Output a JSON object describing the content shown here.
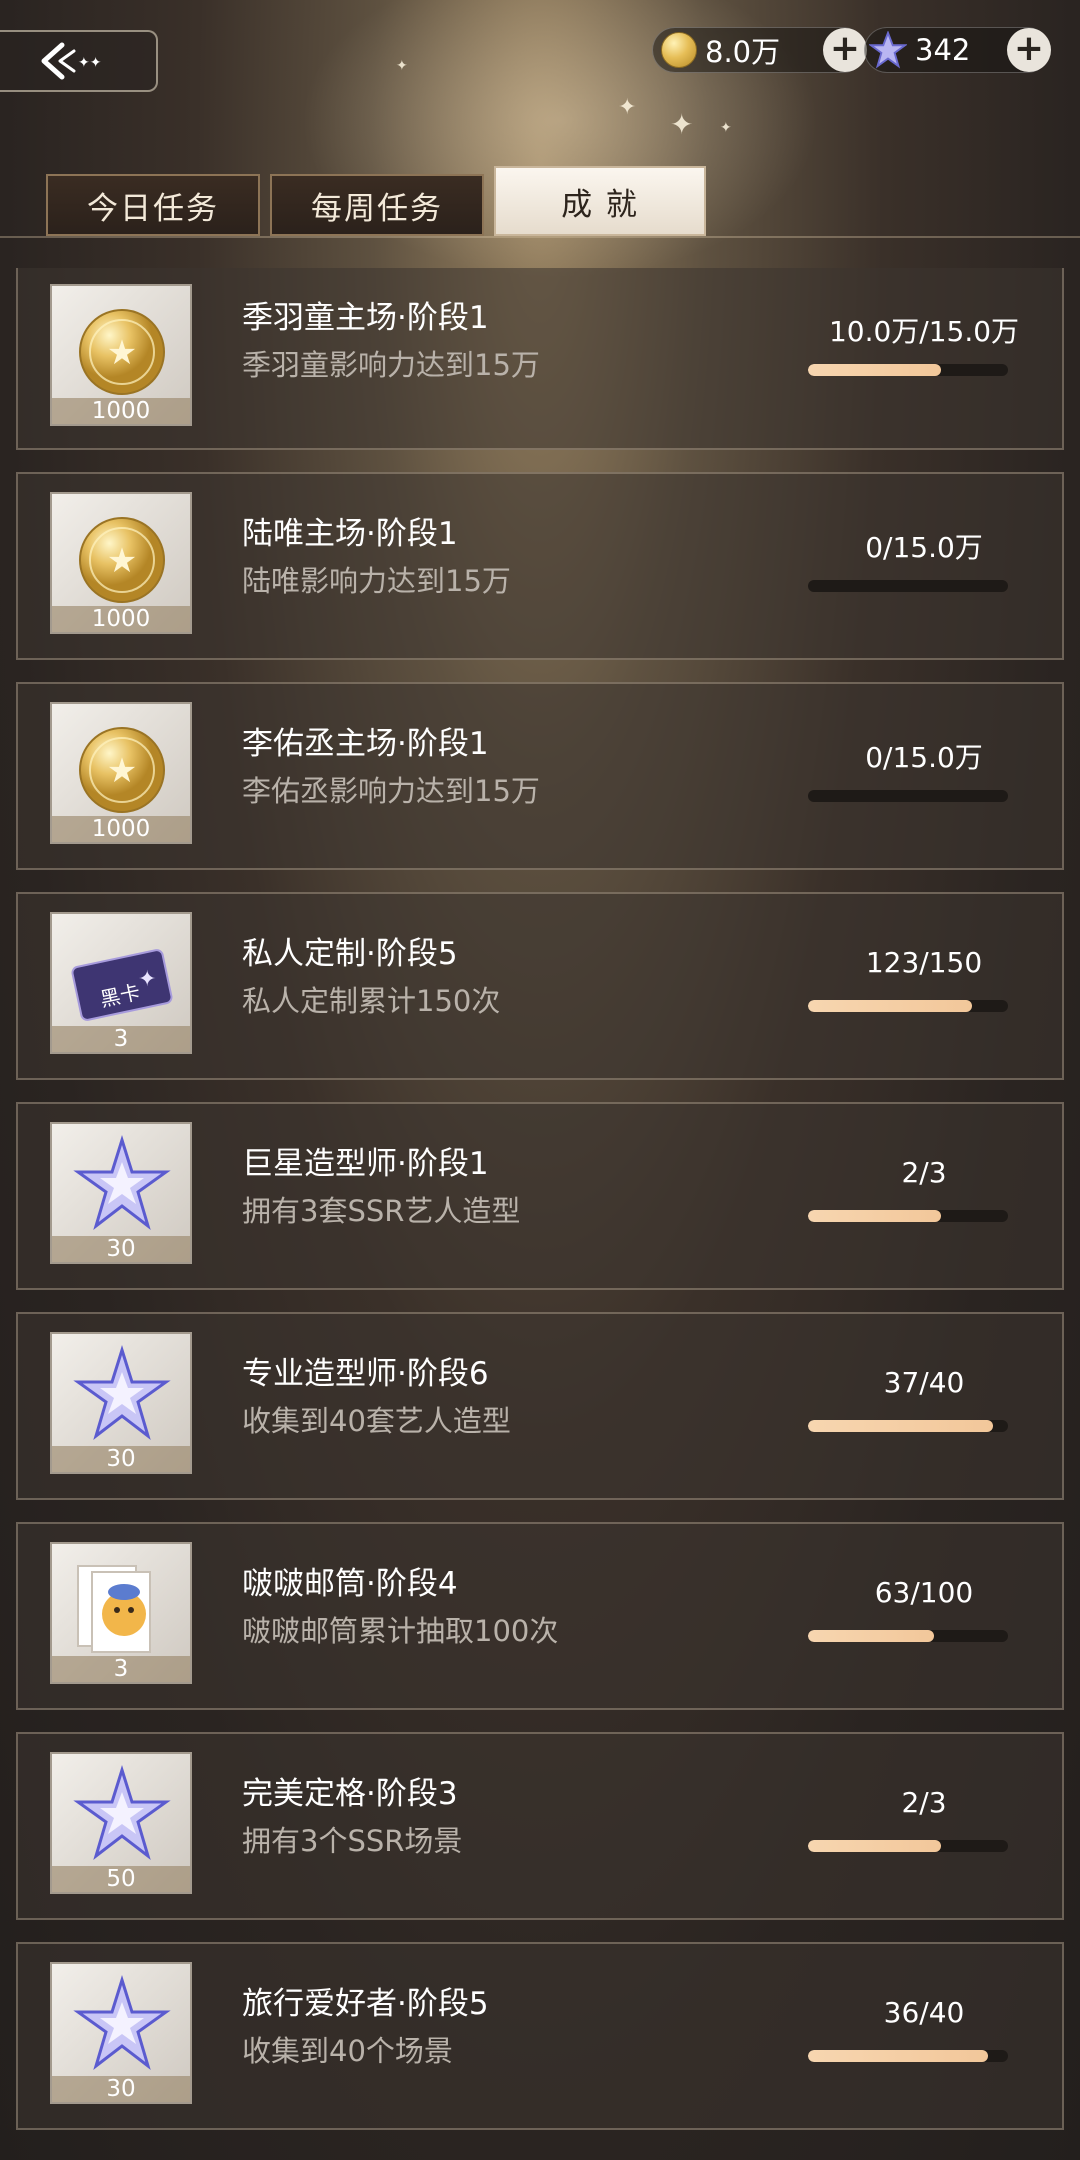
{
  "currency": {
    "coins": {
      "value": "8.0万",
      "icon": "coin-icon"
    },
    "stars": {
      "value": "342",
      "icon": "star-icon"
    }
  },
  "tabs": [
    {
      "label": "今日任务",
      "active": false
    },
    {
      "label": "每周任务",
      "active": false
    },
    {
      "label": "成 就",
      "active": true
    }
  ],
  "achievements": [
    {
      "title": "季羽童主场·阶段1",
      "desc": "季羽童影响力达到15万",
      "progress_text": "10.0万/15.0万",
      "progress": 0.667,
      "reward_icon": "star-coin-icon",
      "reward_qty": "1000"
    },
    {
      "title": "陆唯主场·阶段1",
      "desc": "陆唯影响力达到15万",
      "progress_text": "0/15.0万",
      "progress": 0,
      "reward_icon": "star-coin-icon",
      "reward_qty": "1000"
    },
    {
      "title": "李佑丞主场·阶段1",
      "desc": "李佑丞影响力达到15万",
      "progress_text": "0/15.0万",
      "progress": 0,
      "reward_icon": "star-coin-icon",
      "reward_qty": "1000"
    },
    {
      "title": "私人定制·阶段5",
      "desc": "私人定制累计150次",
      "progress_text": "123/150",
      "progress": 0.82,
      "reward_icon": "black-card-icon",
      "reward_qty": "3"
    },
    {
      "title": "巨星造型师·阶段1",
      "desc": "拥有3套SSR艺人造型",
      "progress_text": "2/3",
      "progress": 0.667,
      "reward_icon": "crystal-star-icon",
      "reward_qty": "30"
    },
    {
      "title": "专业造型师·阶段6",
      "desc": "收集到40套艺人造型",
      "progress_text": "37/40",
      "progress": 0.925,
      "reward_icon": "crystal-star-icon",
      "reward_qty": "30"
    },
    {
      "title": "啵啵邮筒·阶段4",
      "desc": "啵啵邮筒累计抽取100次",
      "progress_text": "63/100",
      "progress": 0.63,
      "reward_icon": "postcard-icon",
      "reward_qty": "3"
    },
    {
      "title": "完美定格·阶段3",
      "desc": "拥有3个SSR场景",
      "progress_text": "2/3",
      "progress": 0.667,
      "reward_icon": "crystal-star-icon",
      "reward_qty": "50"
    },
    {
      "title": "旅行爱好者·阶段5",
      "desc": "收集到40个场景",
      "progress_text": "36/40",
      "progress": 0.9,
      "reward_icon": "crystal-star-icon",
      "reward_qty": "30"
    }
  ]
}
